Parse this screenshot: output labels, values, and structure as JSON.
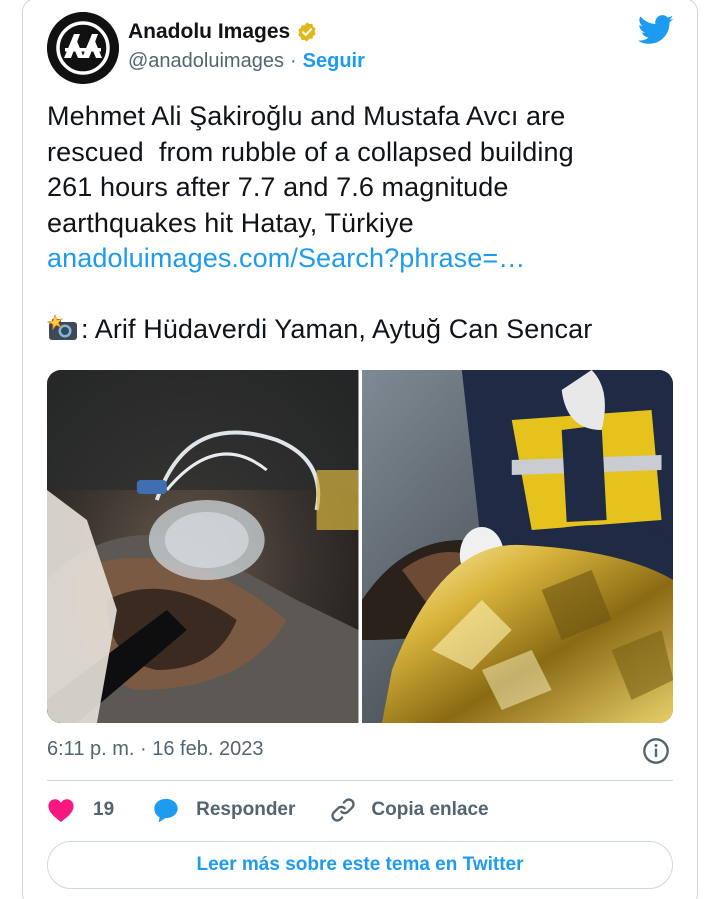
{
  "author": {
    "name": "Anadolu Images",
    "handle": "@anadoluimages",
    "separator": "·",
    "follow_label": "Seguir",
    "verified_color": "#e2b719"
  },
  "tweet": {
    "lines": [
      "Mehmet Ali Şakiroğlu and Mustafa Avcı are",
      "rescued  from rubble of a collapsed building",
      "261 hours after 7.7 and 7.6 magnitude",
      "earthquakes hit Hatay, Türkiye"
    ],
    "link": "anadoluimages.com/Search?phrase=…",
    "credit": ": Arif Hüdaverdi Yaman, Aytuğ Can Sencar",
    "credit_icon": "camera-flash-icon"
  },
  "media": [
    {
      "name": "photo-rescued-man-oxygen-mask"
    },
    {
      "name": "photo-rescued-man-thermal-blanket"
    }
  ],
  "timestamp": "6:11 p. m. · 16 feb. 2023",
  "actions": {
    "like_count": "19",
    "reply_label": "Responder",
    "copy_label": "Copia enlace"
  },
  "read_more_label": "Leer más sobre este tema en Twitter",
  "colors": {
    "accent": "#1d9bf0",
    "like": "#f91880",
    "text": "#0f1419",
    "secondary": "#536471",
    "border": "#cfd9de"
  }
}
